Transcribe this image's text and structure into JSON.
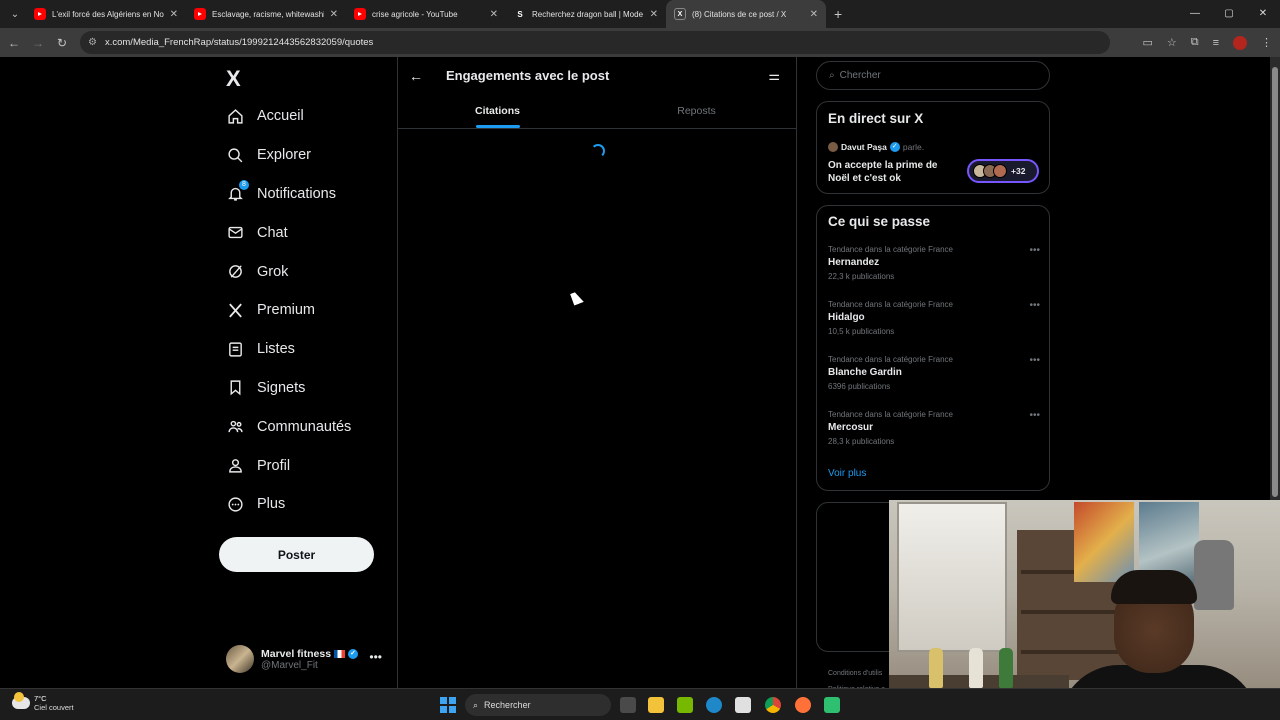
{
  "browser": {
    "tabs": [
      {
        "title": "L'exil forcé des Algériens en No",
        "icon": "youtube-icon",
        "active": false
      },
      {
        "title": "Esclavage, racisme, whitewashin",
        "icon": "youtube-icon",
        "active": false
      },
      {
        "title": "crise agricole - YouTube",
        "icon": "youtube-icon",
        "active": false
      },
      {
        "title": "Recherchez dragon ball | Mode",
        "icon": "s-icon",
        "active": false
      },
      {
        "title": "(8) Citations de ce post / X",
        "icon": "x-icon",
        "active": true
      }
    ],
    "url": "x.com/Media_FrenchRap/status/1999212443562832059/quotes"
  },
  "nav": {
    "logo": "X",
    "items": [
      {
        "label": "Accueil",
        "icon": "home-icon"
      },
      {
        "label": "Explorer",
        "icon": "search-icon"
      },
      {
        "label": "Notifications",
        "icon": "bell-icon",
        "badge": "8"
      },
      {
        "label": "Chat",
        "icon": "mail-icon"
      },
      {
        "label": "Grok",
        "icon": "grok-icon"
      },
      {
        "label": "Premium",
        "icon": "x-premium-icon"
      },
      {
        "label": "Listes",
        "icon": "list-icon"
      },
      {
        "label": "Signets",
        "icon": "bookmark-icon"
      },
      {
        "label": "Communautés",
        "icon": "communities-icon"
      },
      {
        "label": "Profil",
        "icon": "person-icon"
      },
      {
        "label": "Plus",
        "icon": "more-circle-icon"
      }
    ],
    "post_button": "Poster",
    "account": {
      "name": "Marvel fitness",
      "handle": "@Marvel_Fit"
    }
  },
  "main": {
    "title": "Engagements avec le post",
    "tabs": [
      {
        "label": "Citations",
        "selected": true
      },
      {
        "label": "Reposts",
        "selected": false
      }
    ]
  },
  "right": {
    "search_placeholder": "Chercher",
    "live": {
      "title": "En direct sur X",
      "host": "Davut Paşa",
      "speaks": "parle.",
      "topic": "On accepte la prime de Noël et c'est ok",
      "count": "+32"
    },
    "trends": {
      "title": "Ce qui se passe",
      "items": [
        {
          "category": "Tendance dans la catégorie France",
          "name": "Hernandez",
          "count": "22,3 k publications"
        },
        {
          "category": "Tendance dans la catégorie France",
          "name": "Hidalgo",
          "count": "10,5 k publications"
        },
        {
          "category": "Tendance dans la catégorie France",
          "name": "Blanche Gardin",
          "count": "6396 publications"
        },
        {
          "category": "Tendance dans la catégorie France",
          "name": "Mercosur",
          "count": "28,3 k publications"
        }
      ],
      "see_more": "Voir plus"
    },
    "footer": [
      "Conditions d'utilis",
      "Politique relative a"
    ]
  },
  "taskbar": {
    "temp": "7°C",
    "weather": "Ciel couvert",
    "search": "Rechercher"
  },
  "colors": {
    "accent": "#1d9bf0",
    "live_ring": "#7856ff",
    "bg": "#000000",
    "muted": "#71767b"
  }
}
